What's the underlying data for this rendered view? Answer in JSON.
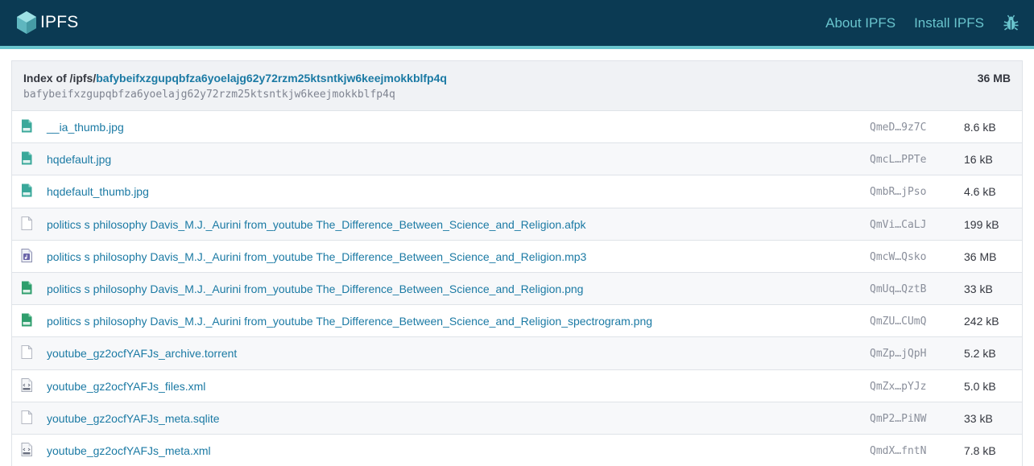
{
  "header": {
    "brand": "IPFS",
    "nav": {
      "about": "About IPFS",
      "install": "Install IPFS",
      "bug_icon": "bug-icon"
    },
    "colors": {
      "bar": "#0b3a53",
      "accent": "#69c4cd"
    }
  },
  "index": {
    "prefix": "Index of /ipfs/",
    "cid": "bafybeifxzgupqbfza6yoelajg62y72rzm25ktsntkjw6keejmokkblfp4q",
    "cid_plain": "bafybeifxzgupqbfza6yoelajg62y72rzm25ktsntkjw6keejmokkblfp4q",
    "total_size": "36 MB"
  },
  "files": [
    {
      "icon": "jpg",
      "name": "__ia_thumb.jpg",
      "hash": "QmeD…9z7C",
      "size": "8.6 kB"
    },
    {
      "icon": "jpg",
      "name": "hqdefault.jpg",
      "hash": "QmcL…PPTe",
      "size": "16 kB"
    },
    {
      "icon": "jpg",
      "name": "hqdefault_thumb.jpg",
      "hash": "QmbR…jPso",
      "size": "4.6 kB"
    },
    {
      "icon": "blank",
      "name": "politics s philosophy Davis_M.J._Aurini from_youtube The_Difference_Between_Science_and_Religion.afpk",
      "hash": "QmVi…CaLJ",
      "size": "199 kB"
    },
    {
      "icon": "mp3",
      "name": "politics s philosophy Davis_M.J._Aurini from_youtube The_Difference_Between_Science_and_Religion.mp3",
      "hash": "QmcW…Qsko",
      "size": "36 MB"
    },
    {
      "icon": "png",
      "name": "politics s philosophy Davis_M.J._Aurini from_youtube The_Difference_Between_Science_and_Religion.png",
      "hash": "QmUq…QztB",
      "size": "33 kB"
    },
    {
      "icon": "png",
      "name": "politics s philosophy Davis_M.J._Aurini from_youtube The_Difference_Between_Science_and_Religion_spectrogram.png",
      "hash": "QmZU…CUmQ",
      "size": "242 kB"
    },
    {
      "icon": "blank",
      "name": "youtube_gz2ocfYAFJs_archive.torrent",
      "hash": "QmZp…jQpH",
      "size": "5.2 kB"
    },
    {
      "icon": "xml",
      "name": "youtube_gz2ocfYAFJs_files.xml",
      "hash": "QmZx…pYJz",
      "size": "5.0 kB"
    },
    {
      "icon": "blank",
      "name": "youtube_gz2ocfYAFJs_meta.sqlite",
      "hash": "QmP2…PiNW",
      "size": "33 kB"
    },
    {
      "icon": "xml",
      "name": "youtube_gz2ocfYAFJs_meta.xml",
      "hash": "QmdX…fntN",
      "size": "7.8 kB"
    }
  ]
}
